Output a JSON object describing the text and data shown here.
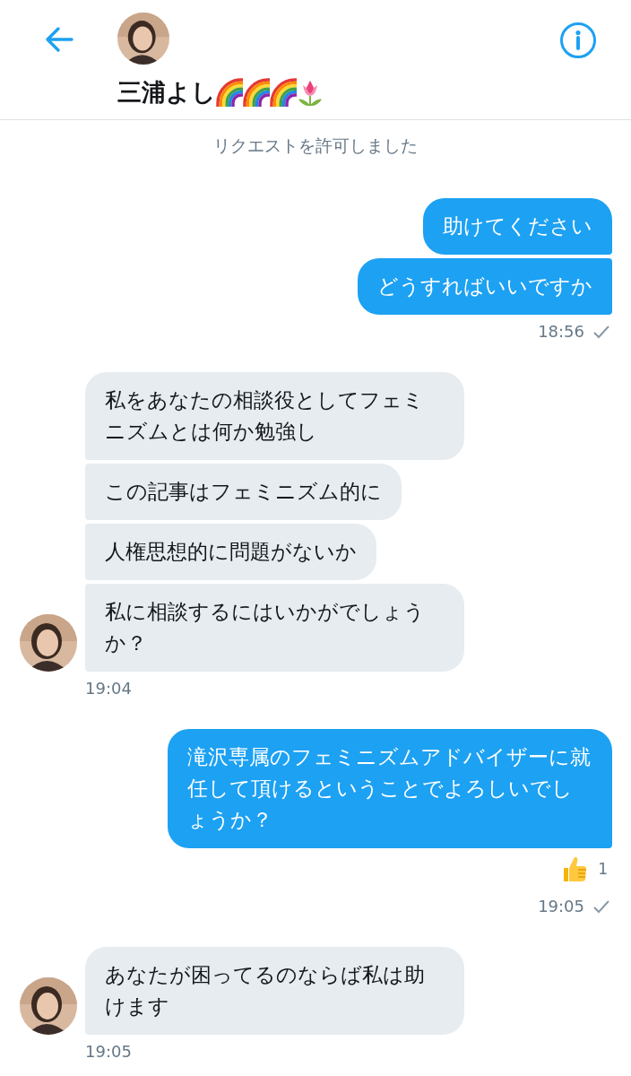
{
  "header": {
    "name": "三浦よし"
  },
  "notice": "リクエストを許可しました",
  "groups": [
    {
      "kind": "sent",
      "messages": [
        "助けてください",
        "どうすればいいですか"
      ],
      "time": "18:56",
      "delivered": true
    },
    {
      "kind": "received",
      "messages": [
        "私をあなたの相談役としてフェミニズムとは何か勉強し",
        "この記事はフェミニズム的に",
        "人権思想的に問題がないか",
        "私に相談するにはいかがでしょうか？"
      ],
      "time": "19:04"
    },
    {
      "kind": "sent",
      "messages": [
        "滝沢専属のフェミニズムアドバイザーに就任して頂けるということでよろしいでしょうか？"
      ],
      "reaction_count": "1",
      "time": "19:05",
      "delivered": true
    },
    {
      "kind": "received",
      "messages": [
        "あなたが困ってるのならば私は助けます"
      ],
      "time": "19:05"
    }
  ]
}
